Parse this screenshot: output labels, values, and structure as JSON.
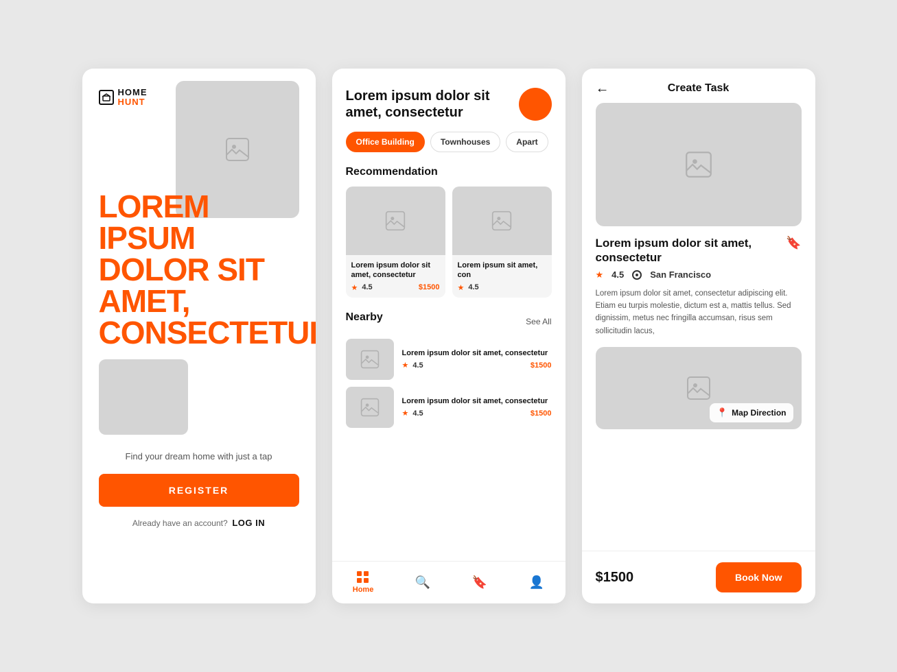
{
  "screen1": {
    "logo_home": "HOME",
    "logo_hunt": "HUNT",
    "big_text": "LOREM IPSUM DOLOR SIT AMET, CONSECTETUR",
    "tagline": "Find your dream home with just a tap",
    "register_label": "REGISTER",
    "login_prompt": "Already have an account?",
    "login_label": "LOG IN"
  },
  "screen2": {
    "title": "Lorem ipsum dolor sit amet, consectetur",
    "tabs": [
      {
        "label": "Office Building",
        "active": true
      },
      {
        "label": "Townhouses",
        "active": false
      },
      {
        "label": "Apart",
        "active": false
      }
    ],
    "recommendation_label": "Recommendation",
    "cards": [
      {
        "title": "Lorem ipsum dolor sit amet, consectetur",
        "rating": "4.5",
        "price": "$1500"
      },
      {
        "title": "Lorem ipsum sit amet, con",
        "rating": "4.5",
        "price": ""
      }
    ],
    "nearby_label": "Nearby",
    "see_all_label": "See All",
    "nearby_items": [
      {
        "title": "Lorem ipsum dolor sit amet, consectetur",
        "rating": "4.5",
        "price": "$1500"
      },
      {
        "title": "Lorem ipsum dolor sit amet, consectetur",
        "rating": "4.5",
        "price": "$1500"
      }
    ],
    "nav_items": [
      {
        "label": "Home",
        "active": true
      },
      {
        "label": "Search",
        "active": false
      },
      {
        "label": "Saved",
        "active": false
      },
      {
        "label": "Profile",
        "active": false
      }
    ]
  },
  "screen3": {
    "back_label": "←",
    "title": "Create Task",
    "detail_title": "Lorem ipsum dolor sit amet, consectetur",
    "bookmark_icon": "🔖",
    "rating": "4.5",
    "location": "San Francisco",
    "description": "Lorem ipsum dolor sit amet, consectetur adipiscing elit. Etiam eu turpis molestie, dictum est a, mattis tellus. Sed dignissim, metus nec fringilla accumsan, risus sem sollicitudin lacus,",
    "map_direction_label": "Map Direction",
    "price": "$1500",
    "book_now_label": "Book Now"
  }
}
